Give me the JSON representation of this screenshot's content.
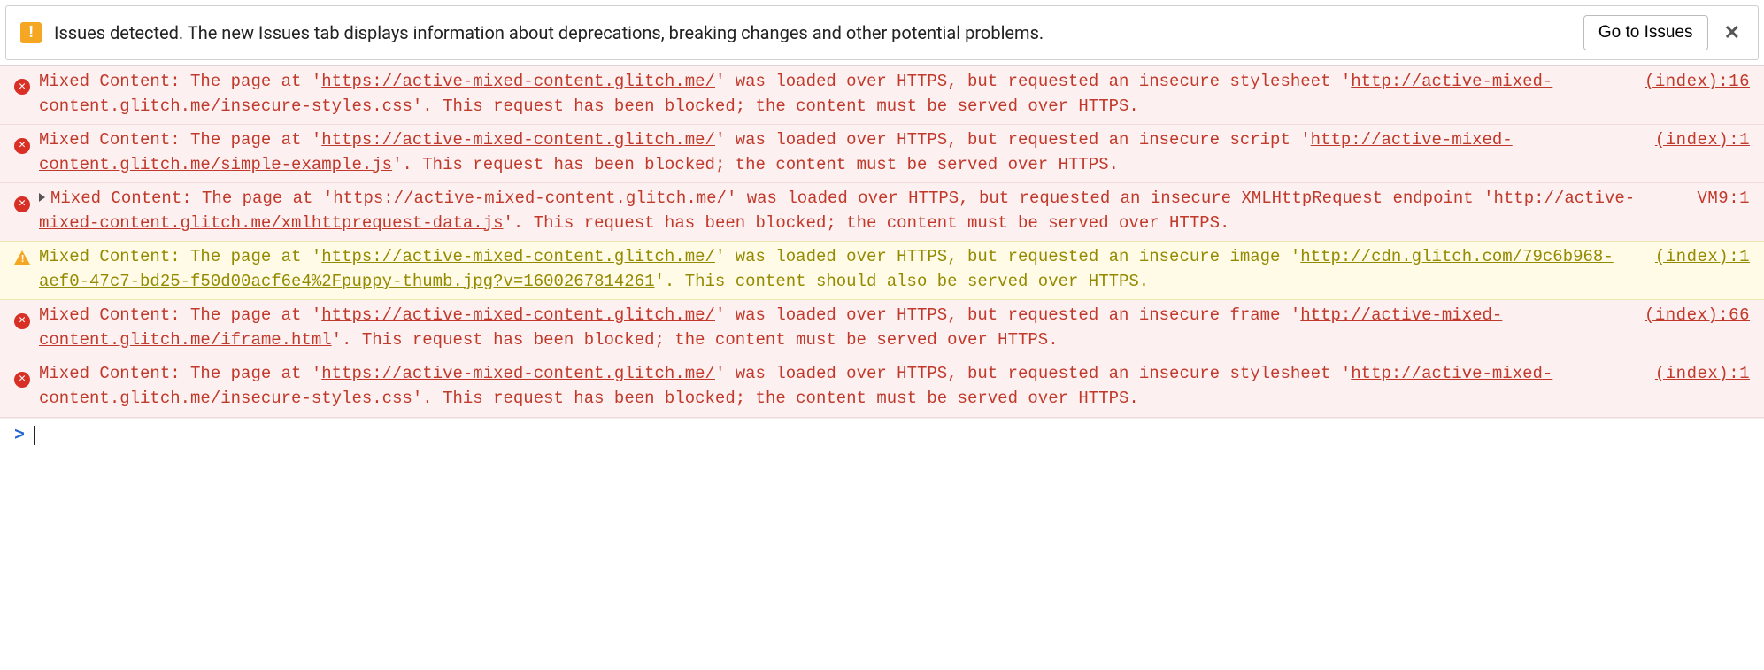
{
  "issues_bar": {
    "text": "Issues detected. The new Issues tab displays information about deprecations, breaking changes and other potential problems.",
    "button": "Go to Issues",
    "close": "✕"
  },
  "messages": [
    {
      "level": "error",
      "expandable": false,
      "prefix": "Mixed Content: The page at '",
      "page_url": "https://active-mixed-content.glitch.me/",
      "mid1": "' was loaded over HTTPS, but requested an insecure stylesheet '",
      "resource_url": "http://active-mixed-content.glitch.me/insecure-styles.css",
      "suffix": "'. This request has been blocked; the content must be served over HTTPS.",
      "source": "(index):16"
    },
    {
      "level": "error",
      "expandable": false,
      "prefix": "Mixed Content: The page at '",
      "page_url": "https://active-mixed-content.glitch.me/",
      "mid1": "' was loaded over HTTPS, but requested an insecure script '",
      "resource_url": "http://active-mixed-content.glitch.me/simple-example.js",
      "suffix": "'. This request has been blocked; the content must be served over HTTPS.",
      "source": "(index):1"
    },
    {
      "level": "error",
      "expandable": true,
      "prefix": "Mixed Content: The page at '",
      "page_url": "https://active-mixed-content.glitch.me/",
      "mid1": "' was loaded over HTTPS, but requested an insecure XMLHttpRequest endpoint '",
      "resource_url": "http://active-mixed-content.glitch.me/xmlhttprequest-data.js",
      "suffix": "'. This request has been blocked; the content must be served over HTTPS.",
      "source": "VM9:1"
    },
    {
      "level": "warning",
      "expandable": false,
      "prefix": "Mixed Content: The page at '",
      "page_url": "https://active-mixed-content.glitch.me/",
      "mid1": "' was loaded over HTTPS, but requested an insecure image '",
      "resource_url": "http://cdn.glitch.com/79c6b968-aef0-47c7-bd25-f50d00acf6e4%2Fpuppy-thumb.jpg?v=1600267814261",
      "suffix": "'. This content should also be served over HTTPS.",
      "source": "(index):1"
    },
    {
      "level": "error",
      "expandable": false,
      "prefix": "Mixed Content: The page at '",
      "page_url": "https://active-mixed-content.glitch.me/",
      "mid1": "' was loaded over HTTPS, but requested an insecure frame '",
      "resource_url": "http://active-mixed-content.glitch.me/iframe.html",
      "suffix": "'. This request has been blocked; the content must be served over HTTPS.",
      "source": "(index):66"
    },
    {
      "level": "error",
      "expandable": false,
      "prefix": "Mixed Content: The page at '",
      "page_url": "https://active-mixed-content.glitch.me/",
      "mid1": "' was loaded over HTTPS, but requested an insecure stylesheet '",
      "resource_url": "http://active-mixed-content.glitch.me/insecure-styles.css",
      "suffix": "'. This request has been blocked; the content must be served over HTTPS.",
      "source": "(index):1"
    }
  ],
  "prompt": ">"
}
